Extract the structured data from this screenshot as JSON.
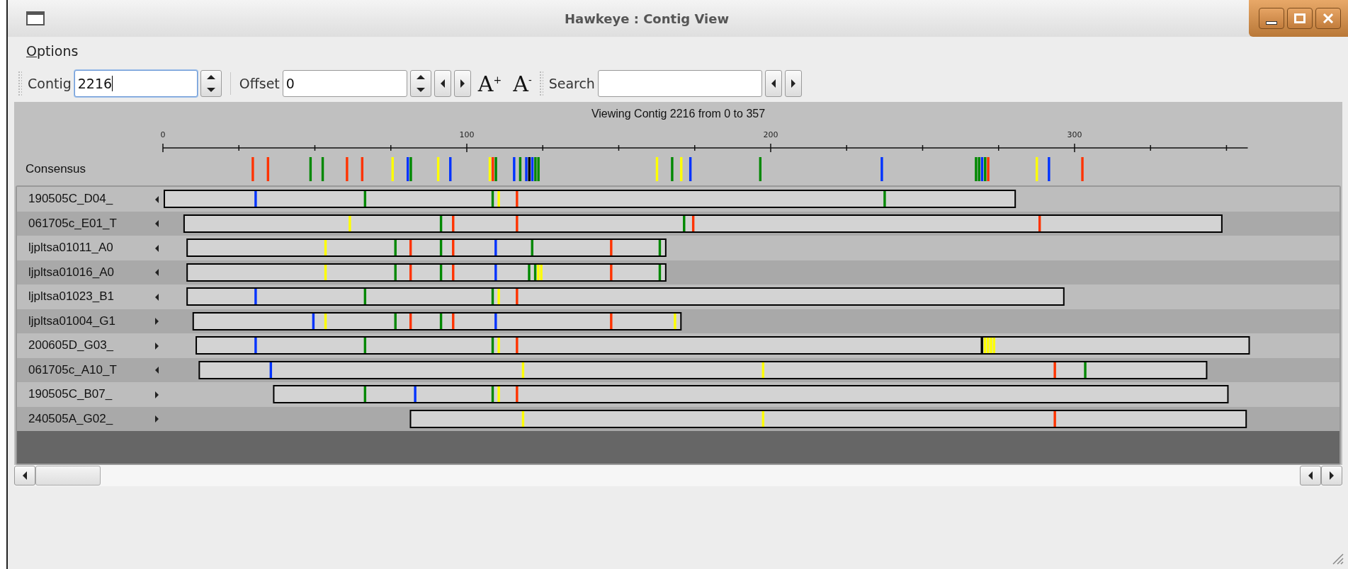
{
  "window": {
    "title": "Hawkeye : Contig View"
  },
  "menu": [
    {
      "label": "Options"
    }
  ],
  "toolbar": {
    "contig": {
      "label": "Contig",
      "value": "2216"
    },
    "offset": {
      "label": "Offset",
      "value": "0"
    },
    "font_buttons": [
      {
        "label": "A$^{+}$"
      },
      {
        "label": "A$^{-}$"
      }
    ],
    "search": {
      "label": "Search"
    }
  },
  "view": {
    "caption": "Viewing Contig 2216 from 0 to 357",
    "ruler": {
      "ticks": [
        "0",
        "100",
        "200",
        "300"
      ]
    },
    "consensus": {
      "label": "Consensus"
    },
    "reads": [
      {
        "label": "190505C_D04_",
        "reverse": true
      },
      {
        "label": "061705c_E01_T",
        "reverse": true
      },
      {
        "label": "ljpltsa01011_A0",
        "reverse": true
      },
      {
        "label": "ljpltsa01016_A0",
        "reverse": true
      },
      {
        "label": "ljpltsa01023_B1",
        "reverse": true
      },
      {
        "label": "ljpltsa01004_G1",
        "reverse": false
      },
      {
        "label": "200605D_G03_",
        "reverse": false
      },
      {
        "label": "061705c_A10_T",
        "reverse": true
      },
      {
        "label": "190505C_B07_",
        "reverse": false
      },
      {
        "label": "240505A_G02_",
        "reverse": false
      }
    ]
  }
}
